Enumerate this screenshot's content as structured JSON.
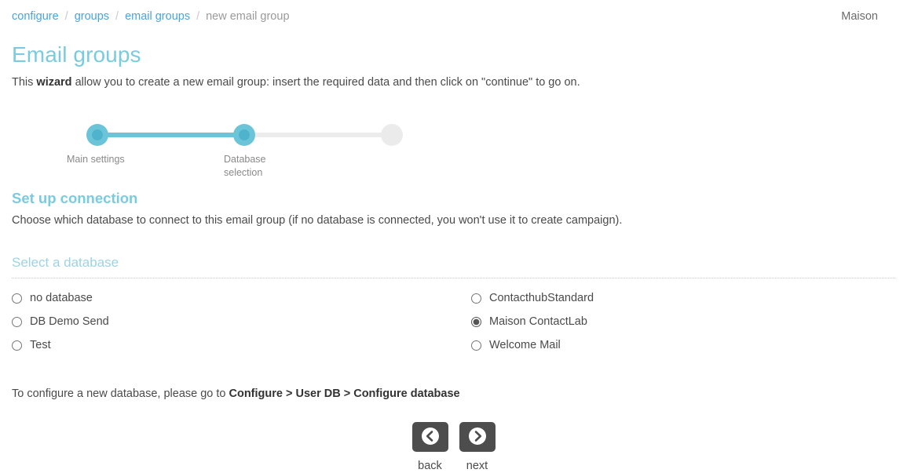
{
  "breadcrumb": {
    "items": [
      {
        "label": "configure",
        "link": true
      },
      {
        "label": "groups",
        "link": true
      },
      {
        "label": "email groups",
        "link": true
      },
      {
        "label": "new email group",
        "link": false
      }
    ],
    "separator": "/"
  },
  "user": {
    "name": "Maison"
  },
  "page": {
    "title": "Email groups",
    "intro_before": "This ",
    "intro_bold": "wizard",
    "intro_after": " allow you to create a new email group: insert the required data and then click on \"continue\" to go on."
  },
  "wizard": {
    "steps": [
      {
        "label": "Main settings",
        "state": "active"
      },
      {
        "label": "Database selection",
        "state": "active"
      },
      {
        "label": "",
        "state": "inactive"
      }
    ],
    "accent_color": "#6cc4d8",
    "inactive_color": "#ebebeb"
  },
  "section": {
    "title": "Set up connection",
    "description": "Choose which database to connect to this email group (if no database is connected, you won't use it to create campaign).",
    "legend": "Select a database"
  },
  "databases": {
    "left": [
      {
        "label": "no database",
        "selected": false
      },
      {
        "label": "DB Demo Send",
        "selected": false
      },
      {
        "label": "Test",
        "selected": false
      }
    ],
    "right": [
      {
        "label": "ContacthubStandard",
        "selected": false
      },
      {
        "label": "Maison ContactLab",
        "selected": true
      },
      {
        "label": "Welcome Mail",
        "selected": false
      }
    ]
  },
  "footer": {
    "note_before": "To configure a new database, please go to ",
    "note_bold": "Configure > User DB > Configure database"
  },
  "nav": {
    "back": {
      "caption": "back",
      "icon": "chevron-left-circle-icon"
    },
    "next": {
      "caption": "next",
      "icon": "chevron-right-circle-icon"
    }
  },
  "colors": {
    "link": "#4aa3df",
    "title": "#79cbe0",
    "legend": "#9bd4e4",
    "button": "#4d4d4d"
  }
}
